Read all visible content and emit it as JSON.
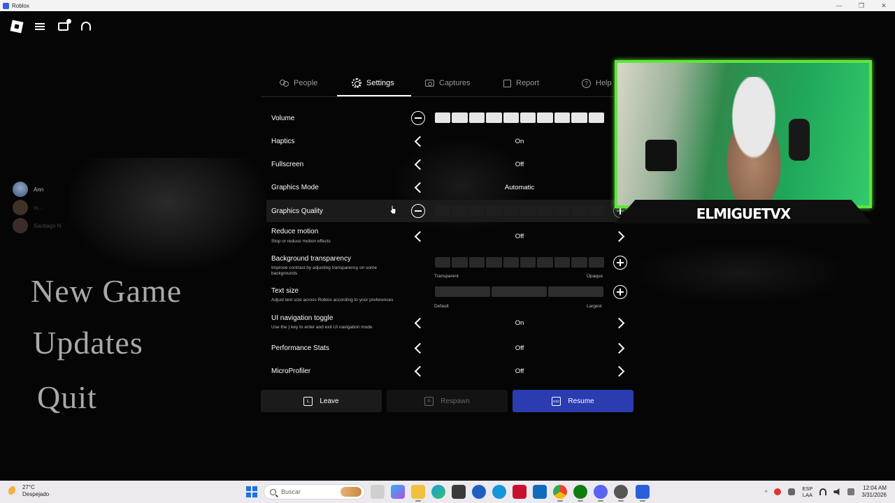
{
  "window": {
    "title": "Roblox",
    "controls": [
      "—",
      "❐",
      "✕"
    ]
  },
  "players": [
    {
      "name": "Ann"
    },
    {
      "name": "m..."
    },
    {
      "name": "Santiago N"
    }
  ],
  "game_menu": {
    "new_game": "New Game",
    "updates": "Updates",
    "quit": "Quit"
  },
  "tabs": [
    {
      "label": "People",
      "icon": "people-icon"
    },
    {
      "label": "Settings",
      "icon": "gear-icon",
      "active": true
    },
    {
      "label": "Captures",
      "icon": "camera-icon"
    },
    {
      "label": "Report",
      "icon": "flag-icon"
    },
    {
      "label": "Help",
      "icon": "help-icon"
    }
  ],
  "settings": {
    "volume": {
      "label": "Volume",
      "level": 10,
      "max": 10
    },
    "haptics": {
      "label": "Haptics",
      "value": "On"
    },
    "fullscreen": {
      "label": "Fullscreen",
      "value": "Off"
    },
    "graphics_mode": {
      "label": "Graphics Mode",
      "value": "Automatic"
    },
    "graphics_quality": {
      "label": "Graphics Quality",
      "level": 0,
      "max": 10
    },
    "reduce_motion": {
      "label": "Reduce motion",
      "desc": "Stop or reduce motion effects",
      "value": "Off"
    },
    "background_transparency": {
      "label": "Background transparency",
      "desc": "Improve contrast by adjusting transparency on some backgrounds",
      "min_label": "Transparent",
      "max_label": "Opaque",
      "level": 0,
      "max": 10
    },
    "text_size": {
      "label": "Text size",
      "desc": "Adjust text size across Roblox according to your preferences",
      "min_label": "Default",
      "max_label": "Largest",
      "level": 0,
      "max": 3
    },
    "ui_navigation_toggle": {
      "label": "UI navigation toggle",
      "desc": "Use the } key to enter and exit UI navigation mode",
      "value": "On"
    },
    "performance_stats": {
      "label": "Performance Stats",
      "value": "Off"
    },
    "microprofiler": {
      "label": "MicroProfiler",
      "value": "Off"
    }
  },
  "actions": {
    "leave": {
      "label": "Leave",
      "key": "L"
    },
    "respawn": {
      "label": "Respawn",
      "key": "R"
    },
    "resume": {
      "label": "Resume",
      "key": "ESC"
    }
  },
  "webcam": {
    "overlay_name": "ELMIGUETVX",
    "accent": "#5ee63a"
  },
  "taskbar": {
    "weather_temp": "27°C",
    "weather_desc": "Despejado",
    "search_placeholder": "Buscar",
    "lang_1": "ESP",
    "lang_2": "LAA",
    "time": "12:04 AM",
    "date": "3/31/2026"
  },
  "colors": {
    "accent_blue": "#2a3cb0",
    "panel_bg": "#000000",
    "segment_active": "#e6e6e6",
    "segment_inactive": "#2a2a2a"
  }
}
